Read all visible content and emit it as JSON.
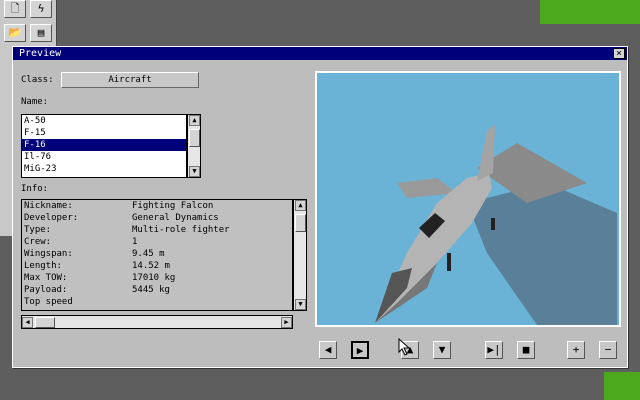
{
  "toolbar": {
    "icons": [
      "new-file-icon",
      "lightning-icon",
      "open-folder-icon",
      "list-icon"
    ],
    "glyphs": [
      "🗋",
      "ϟ",
      "📂",
      "▤"
    ]
  },
  "window": {
    "title": "Preview",
    "close_glyph": "×"
  },
  "class_label": "Class:",
  "class_value": "Aircraft",
  "name_label": "Name:",
  "names": [
    "A-50",
    "F-15",
    "F-16",
    "Il-76",
    "MiG-23"
  ],
  "selected_name": "F-16",
  "info_label": "Info:",
  "info_rows": [
    {
      "key": "Nickname:",
      "value": "Fighting Falcon"
    },
    {
      "key": "Developer:",
      "value": "General Dynamics"
    },
    {
      "key": "Type:",
      "value": "Multi-role fighter"
    },
    {
      "key": "Crew:",
      "value": "1"
    },
    {
      "key": "Wingspan:",
      "value": "9.45 m"
    },
    {
      "key": "Length:",
      "value": "14.52 m"
    },
    {
      "key": "Max TOW:",
      "value": "17010 kg"
    },
    {
      "key": "Payload:",
      "value": "5445 kg"
    },
    {
      "key": "Top speed",
      "value": ""
    }
  ],
  "controls": {
    "prev": "◀",
    "play": "▶",
    "up": "▲",
    "down": "▼",
    "skip_end": "▶|",
    "stop": "■",
    "zoom_in": "+",
    "zoom_out": "−"
  },
  "colors": {
    "title_bar": "#00007a",
    "selection": "#00007a",
    "preview_sky": "#6ab2d6",
    "desktop_green": "#4ca81c"
  }
}
